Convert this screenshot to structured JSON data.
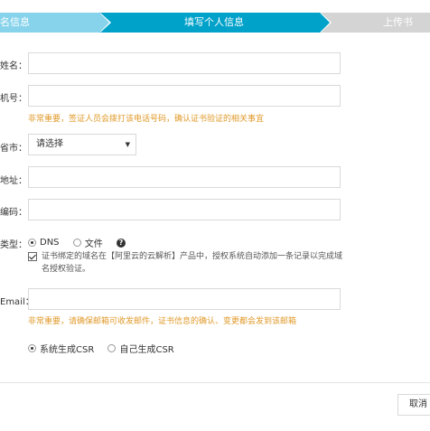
{
  "steps": {
    "step1": "名信息",
    "step2": "填写个人信息",
    "step3": "上传书"
  },
  "form": {
    "name_label": "姓名：",
    "phone_label": "机号：",
    "phone_hint": "非常重要，签证人员会拨打该电话号码，确认证书验证的相关事宜",
    "province_label": "省市：",
    "province_select": "请选择",
    "address_label": "地址：",
    "postcode_label": "编码：",
    "verify_type_label": "类型：",
    "verify_option_dns": "DNS",
    "verify_option_file": "文件",
    "auto_dns_text": "证书绑定的域名在【阿里云的云解析】产品中，授权系统自动添加一条记录以完成域名授权验证。",
    "email_label": "Email：",
    "email_hint": "非常重要，请确保邮箱可收发邮件，证书信息的确认、变更都会发到该邮箱",
    "csr_option_system": "系统生成CSR",
    "csr_option_self": "自己生成CSR"
  },
  "footer": {
    "cancel_label": "取消"
  }
}
